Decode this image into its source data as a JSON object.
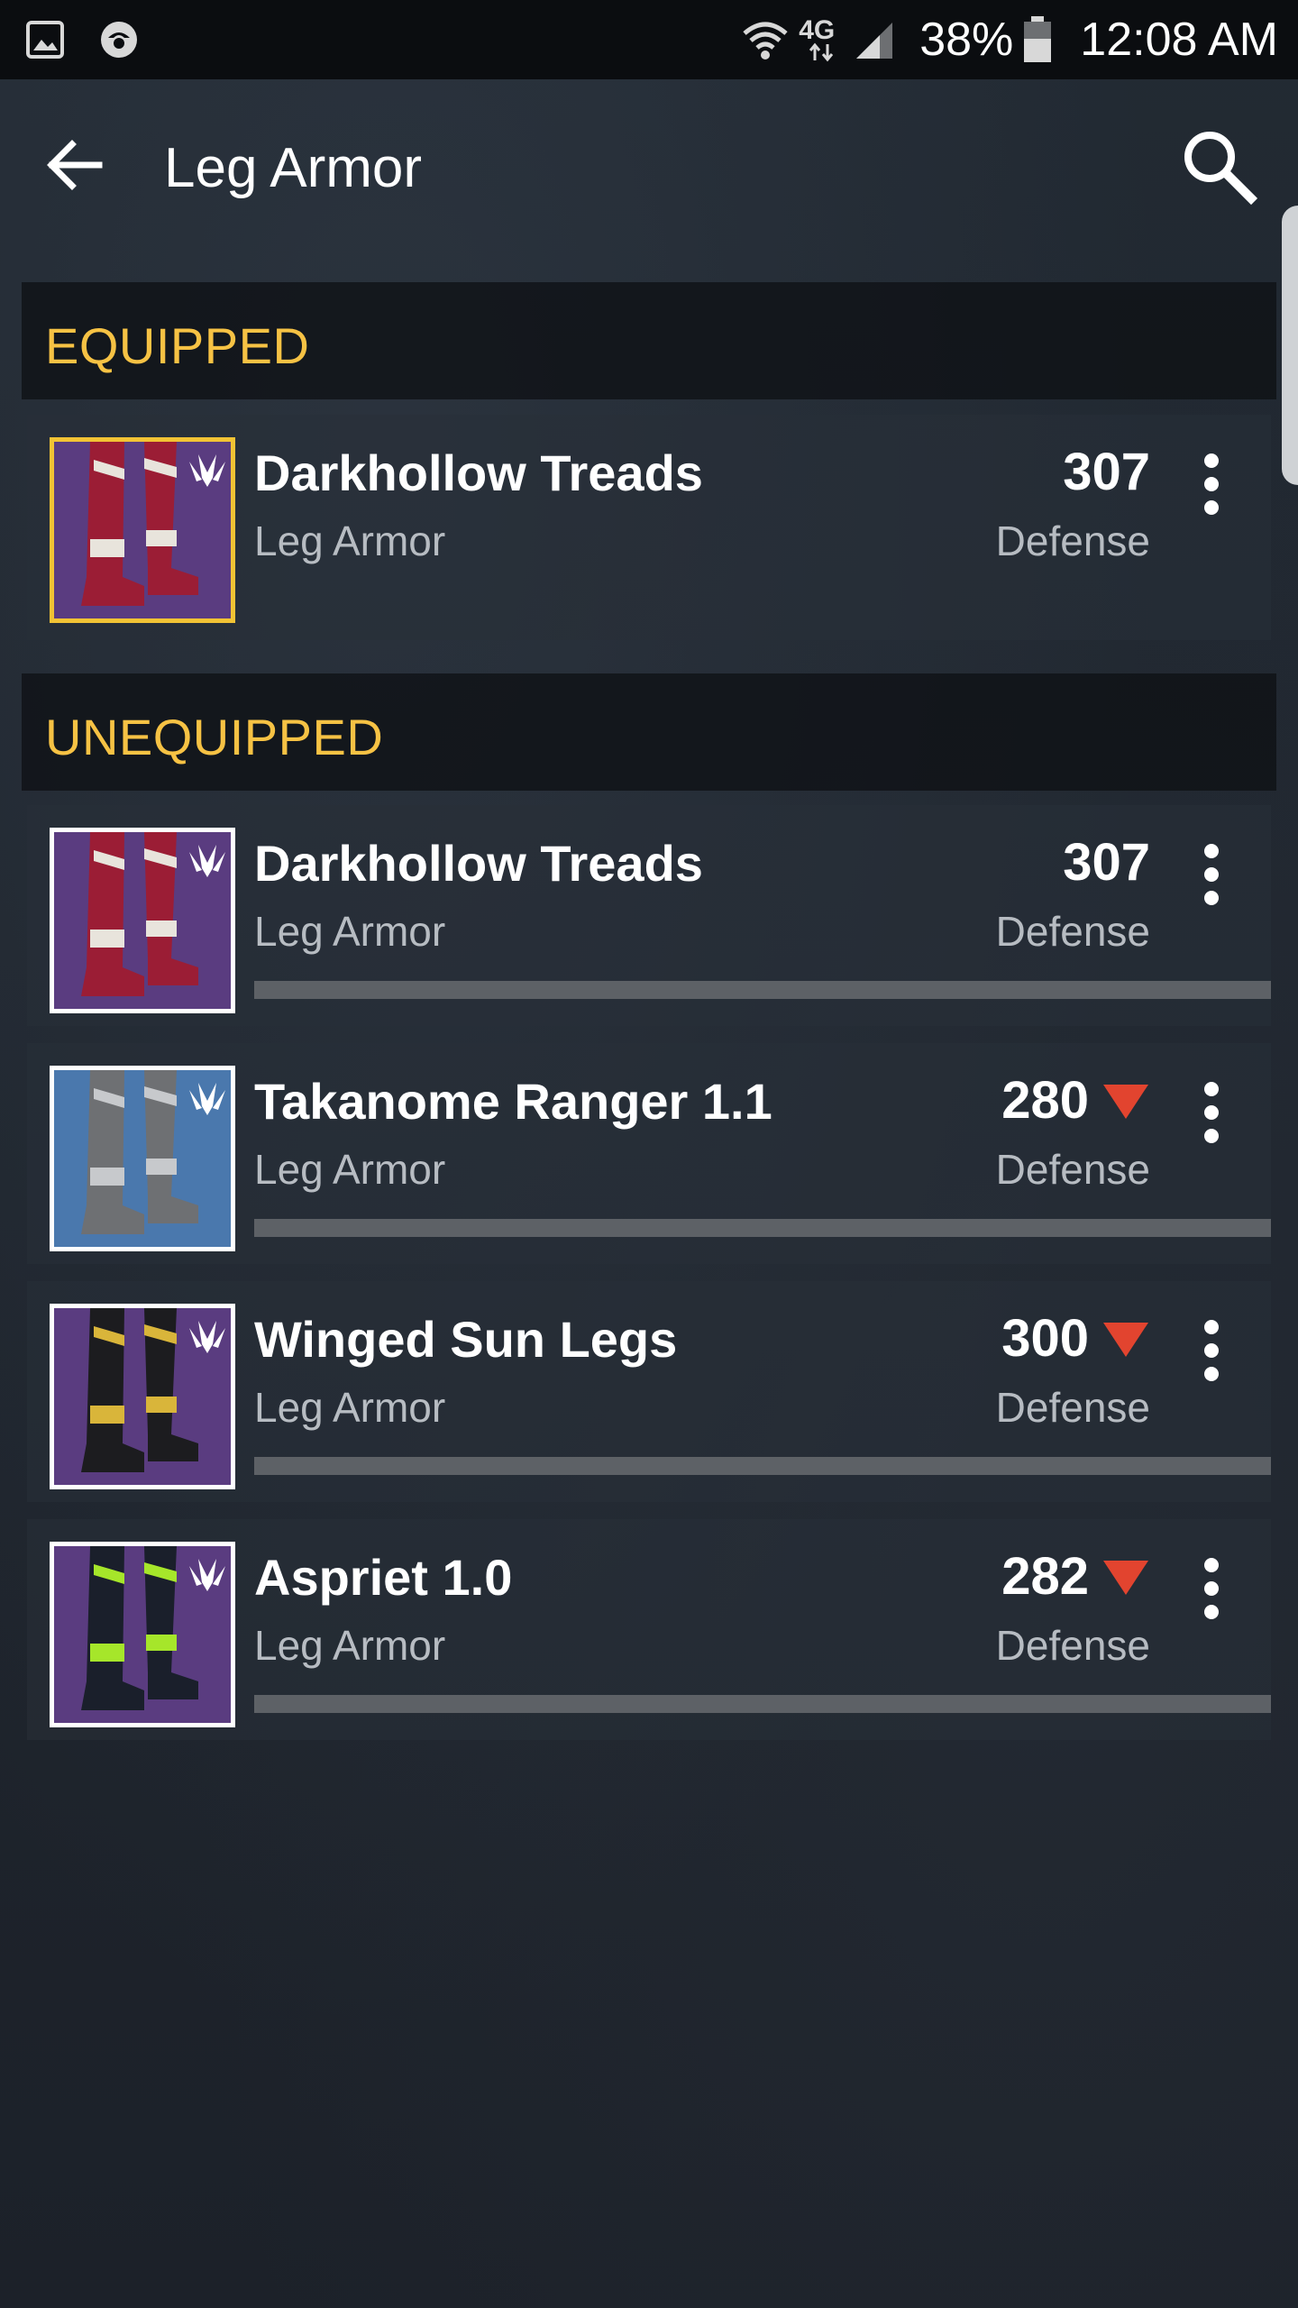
{
  "status_bar": {
    "battery": "38%",
    "time": "12:08 AM",
    "network": "4G",
    "icons": [
      "gallery-icon",
      "app-notification-icon",
      "wifi-icon",
      "network-4g-icon",
      "signal-icon",
      "battery-icon"
    ]
  },
  "header": {
    "title": "Leg Armor",
    "back_icon": "back-arrow-icon",
    "search_icon": "search-icon"
  },
  "sections": {
    "equipped": {
      "label": "EQUIPPED"
    },
    "unequipped": {
      "label": "UNEQUIPPED"
    }
  },
  "items": [
    {
      "name": "Darkhollow Treads",
      "type": "Leg Armor",
      "value": "307",
      "stat": "Defense",
      "lower": false,
      "equipped": true,
      "progress": null,
      "thumb_colors": {
        "bg": "#5a3c80",
        "boot": "#9b1d35",
        "accent": "#e8e4dc"
      }
    },
    {
      "name": "Darkhollow Treads",
      "type": "Leg Armor",
      "value": "307",
      "stat": "Defense",
      "lower": false,
      "equipped": false,
      "progress": 0,
      "thumb_colors": {
        "bg": "#5a3c80",
        "boot": "#9b1d35",
        "accent": "#e8e4dc"
      }
    },
    {
      "name": "Takanome Ranger 1.1",
      "type": "Leg Armor",
      "value": "280",
      "stat": "Defense",
      "lower": true,
      "equipped": false,
      "progress": 0,
      "thumb_colors": {
        "bg": "#4a78ad",
        "boot": "#6e7073",
        "accent": "#c7c9cc"
      }
    },
    {
      "name": "Winged Sun Legs",
      "type": "Leg Armor",
      "value": "300",
      "stat": "Defense",
      "lower": true,
      "equipped": false,
      "progress": 0,
      "thumb_colors": {
        "bg": "#5a3c80",
        "boot": "#1c1c1f",
        "accent": "#d9b53a"
      }
    },
    {
      "name": "Aspriet 1.0",
      "type": "Leg Armor",
      "value": "282",
      "stat": "Defense",
      "lower": true,
      "equipped": false,
      "progress": 0,
      "thumb_colors": {
        "bg": "#5a3c80",
        "boot": "#1a1f2b",
        "accent": "#a6e62a"
      }
    }
  ],
  "colors": {
    "section_label": "#f6c244",
    "lower_indicator": "#e2442f",
    "equipped_border": "#f2c334"
  }
}
